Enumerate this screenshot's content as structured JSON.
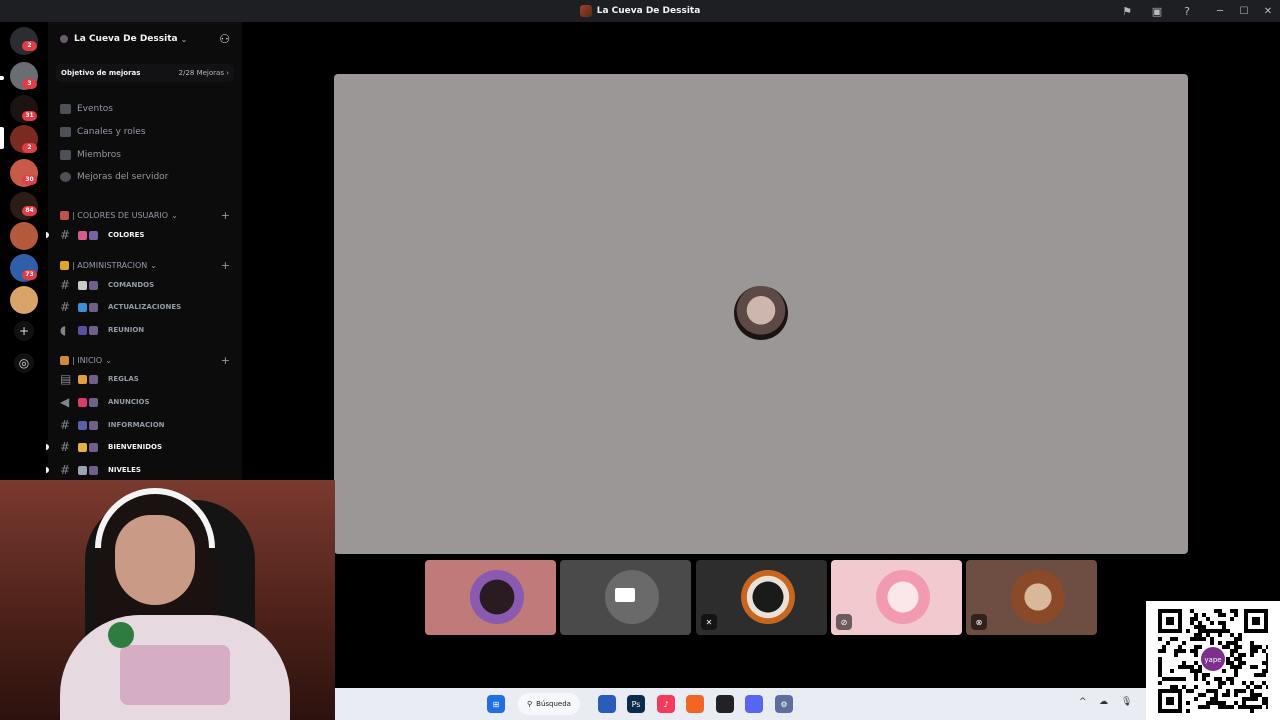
{
  "window": {
    "title": "La Cueva De Dessita",
    "controls": {
      "minimize": "─",
      "maximize": "☐",
      "close": "✕"
    }
  },
  "server_rail": {
    "badges": [
      "2",
      "3",
      "31",
      "2",
      "30",
      "84",
      "73"
    ],
    "add_label": "+",
    "discover_label": "◎"
  },
  "sidebar": {
    "server_name": "La Cueva De Dessita",
    "boost_goal": {
      "label": "Objetivo de mejoras",
      "value": "2/28 Mejoras ›"
    },
    "nav": [
      "Eventos",
      "Canales y roles",
      "Miembros",
      "Mejoras del servidor"
    ],
    "categories": [
      {
        "name": "| COLORES DE USUARIO",
        "channels": [
          {
            "name": "COLORES",
            "active": true
          }
        ]
      },
      {
        "name": "| ADMINISTRACION",
        "channels": [
          {
            "name": "COMANDOS",
            "active": false
          },
          {
            "name": "ACTUALIZACIONES",
            "active": false
          },
          {
            "name": "REUNION",
            "active": false
          }
        ]
      },
      {
        "name": "| INICIO",
        "channels": [
          {
            "name": "REGLAS",
            "active": false
          },
          {
            "name": "ANUNCIOS",
            "active": false
          },
          {
            "name": "INFORMACION",
            "active": false
          },
          {
            "name": "BIENVENIDOS",
            "active": true
          },
          {
            "name": "NIVELES",
            "active": true
          }
        ]
      }
    ]
  },
  "voice": {
    "participants": [
      {
        "status": "",
        "bg": "#c07a7a"
      },
      {
        "status": "camera",
        "bg": "#4a4a4a"
      },
      {
        "status": "muted",
        "bg": "#2d2d2d"
      },
      {
        "status": "deafened",
        "bg": "#f2c9cf"
      },
      {
        "status": "camera-off",
        "bg": "#6e4d42"
      }
    ]
  },
  "taskbar": {
    "search_label": "Búsqueda",
    "tray_icons": [
      "^",
      "☁",
      "🎙"
    ]
  },
  "qr": {
    "caption": "yape"
  }
}
